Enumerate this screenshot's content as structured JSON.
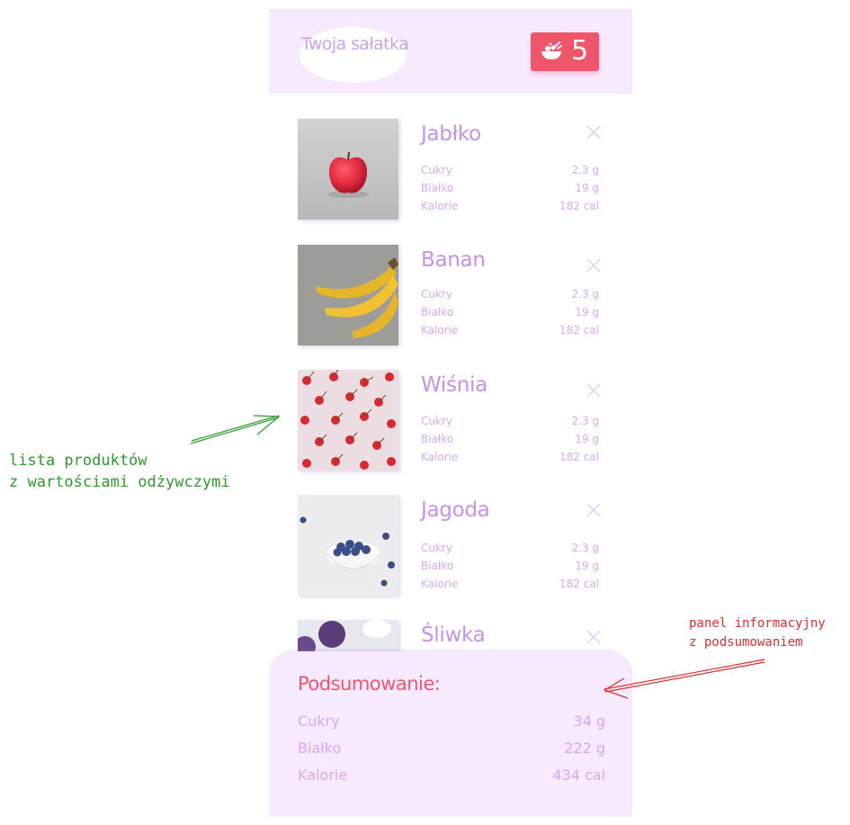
{
  "header": {
    "title": "Twoja sałatka",
    "count": "5",
    "count_icon": "salad-bowl-icon"
  },
  "colors": {
    "header_bg": "#f7e9fe",
    "accent_red": "#f0566a",
    "text_purple": "#c890e8",
    "text_light": "#d6aaf1",
    "summary_bg": "#f7e9fe"
  },
  "products": [
    {
      "name": "Jabłko",
      "nutrients": [
        {
          "label": "Cukry",
          "value": "2.3 g"
        },
        {
          "label": "Białko",
          "value": "19 g"
        },
        {
          "label": "Kalorie",
          "value": "182 cal"
        }
      ]
    },
    {
      "name": "Banan",
      "nutrients": [
        {
          "label": "Cukry",
          "value": "2.3 g"
        },
        {
          "label": "Białko",
          "value": "19 g"
        },
        {
          "label": "Kalorie",
          "value": "182 cal"
        }
      ]
    },
    {
      "name": "Wiśnia",
      "nutrients": [
        {
          "label": "Cukry",
          "value": "2.3 g"
        },
        {
          "label": "Białko",
          "value": "19 g"
        },
        {
          "label": "Kalorie",
          "value": "182 cal"
        }
      ]
    },
    {
      "name": "Jagoda",
      "nutrients": [
        {
          "label": "Cukry",
          "value": "2.3 g"
        },
        {
          "label": "Białko",
          "value": "19 g"
        },
        {
          "label": "Kalorie",
          "value": "182 cal"
        }
      ]
    },
    {
      "name": "Śliwka"
    }
  ],
  "summary": {
    "title": "Podsumowanie:",
    "rows": [
      {
        "label": "Cukry",
        "value": "34 g"
      },
      {
        "label": "Białko",
        "value": "222 g"
      },
      {
        "label": "Kalorie",
        "value": "434 cal"
      }
    ]
  },
  "annotations": {
    "product_list": [
      "lista produktów",
      "z wartościami odżywczymi"
    ],
    "summary_panel": [
      "panel informacyjny",
      "z podsumowaniem"
    ]
  }
}
